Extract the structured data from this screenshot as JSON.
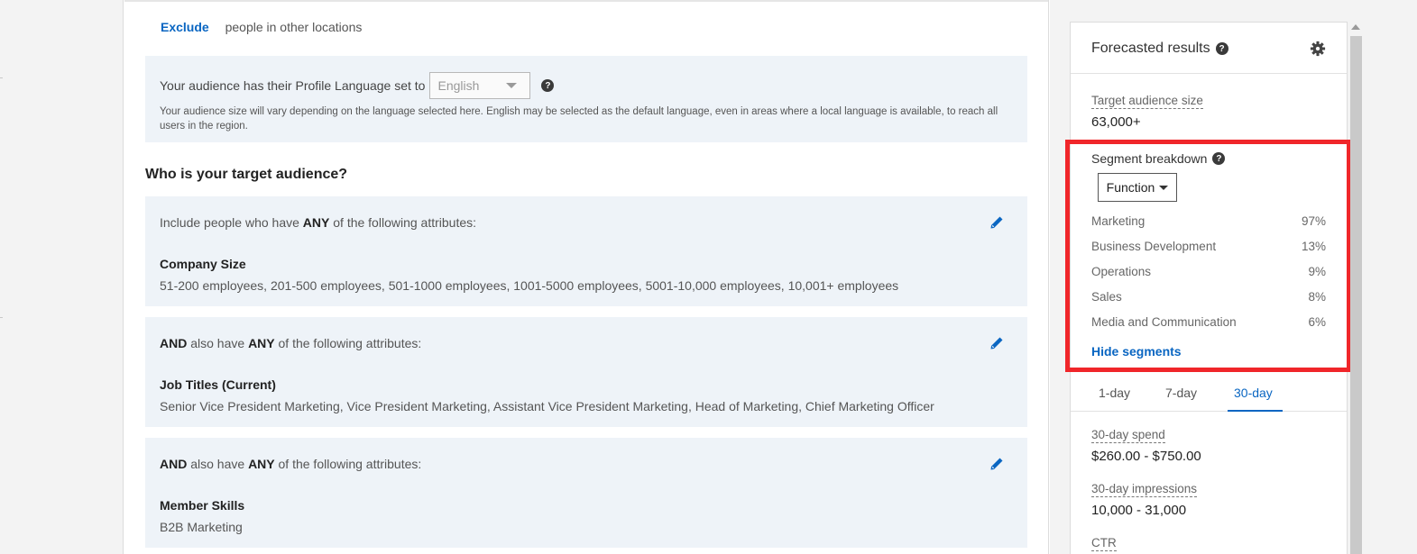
{
  "exclude": {
    "link": "Exclude",
    "text": "people in other locations"
  },
  "language": {
    "prompt": "Your audience has their Profile Language set to",
    "selected": "English",
    "note": "Your audience size will vary depending on the language selected here. English may be selected as the default language, even in areas where a local language is available, to reach all users in the region."
  },
  "audience": {
    "title": "Who is your target audience?",
    "groups": [
      {
        "prefix": "Include people who have ",
        "keyword": "ANY",
        "suffix": " of the following attributes:",
        "category": "Company Size",
        "values": "51-200 employees, 201-500 employees, 501-1000 employees, 1001-5000 employees, 5001-10,000 employees, 10,001+ employees"
      },
      {
        "prefix": "AND",
        "mid": " also have ",
        "keyword": "ANY",
        "suffix": " of the following attributes:",
        "category": "Job Titles (Current)",
        "values": "Senior Vice President Marketing, Vice President Marketing, Assistant Vice President Marketing, Head of Marketing, Chief Marketing Officer"
      },
      {
        "prefix": "AND",
        "mid": " also have ",
        "keyword": "ANY",
        "suffix": " of the following attributes:",
        "category": "Member Skills",
        "values": "B2B Marketing"
      }
    ]
  },
  "forecast": {
    "title": "Forecasted results",
    "audience_label": "Target audience size",
    "audience_value": "63,000+",
    "segment_title": "Segment breakdown",
    "segment_dropdown": "Function",
    "segments": [
      {
        "name": "Marketing",
        "pct": "97%"
      },
      {
        "name": "Business Development",
        "pct": "13%"
      },
      {
        "name": "Operations",
        "pct": "9%"
      },
      {
        "name": "Sales",
        "pct": "8%"
      },
      {
        "name": "Media and Communication",
        "pct": "6%"
      }
    ],
    "hide_segments": "Hide segments",
    "tabs": [
      "1-day",
      "7-day",
      "30-day"
    ],
    "active_tab": "30-day",
    "stats": [
      {
        "label": "30-day spend",
        "value": "$260.00 - $750.00"
      },
      {
        "label": "30-day impressions",
        "value": "10,000 - 31,000"
      },
      {
        "label": "CTR",
        "value": ""
      }
    ]
  },
  "colors": {
    "accent": "#0a66c2",
    "highlight": "#f0262a",
    "panel_bg": "#eef3f8"
  },
  "icons": {
    "help": "help-circle-icon",
    "settings": "gear-icon",
    "edit": "pencil-icon",
    "dropdown": "caret-down-icon"
  }
}
